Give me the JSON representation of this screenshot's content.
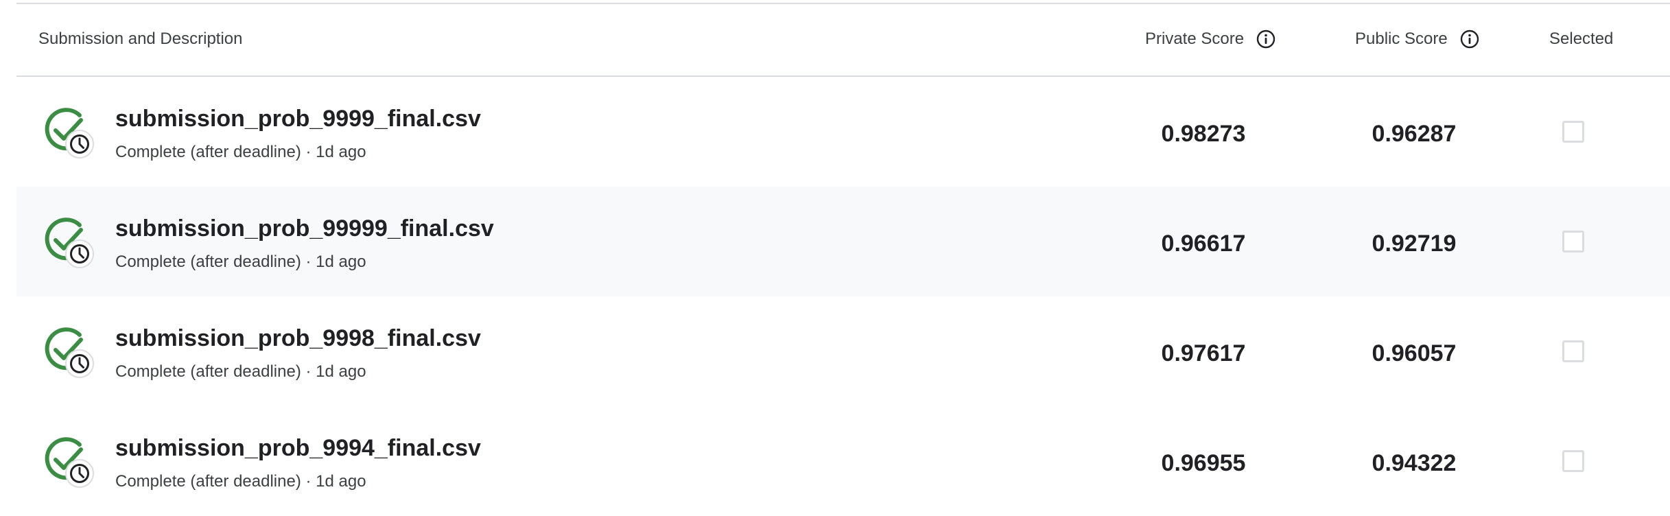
{
  "header": {
    "submission_label": "Submission and Description",
    "private_score_label": "Private Score",
    "public_score_label": "Public Score",
    "selected_label": "Selected"
  },
  "colors": {
    "success_green": "#3b8d44",
    "divider": "#dadce0",
    "alt_row_bg": "#f8f9fa"
  },
  "icons": {
    "status": "check-clock-icon",
    "info": "info-icon"
  },
  "submissions": [
    {
      "file": "submission_prob_9999_final.csv",
      "status": "Complete (after deadline) · 1d ago",
      "private_score": "0.98273",
      "public_score": "0.96287",
      "selected": false
    },
    {
      "file": "submission_prob_99999_final.csv",
      "status": "Complete (after deadline) · 1d ago",
      "private_score": "0.96617",
      "public_score": "0.92719",
      "selected": false
    },
    {
      "file": "submission_prob_9998_final.csv",
      "status": "Complete (after deadline) · 1d ago",
      "private_score": "0.97617",
      "public_score": "0.96057",
      "selected": false
    },
    {
      "file": "submission_prob_9994_final.csv",
      "status": "Complete (after deadline) · 1d ago",
      "private_score": "0.96955",
      "public_score": "0.94322",
      "selected": false
    }
  ]
}
